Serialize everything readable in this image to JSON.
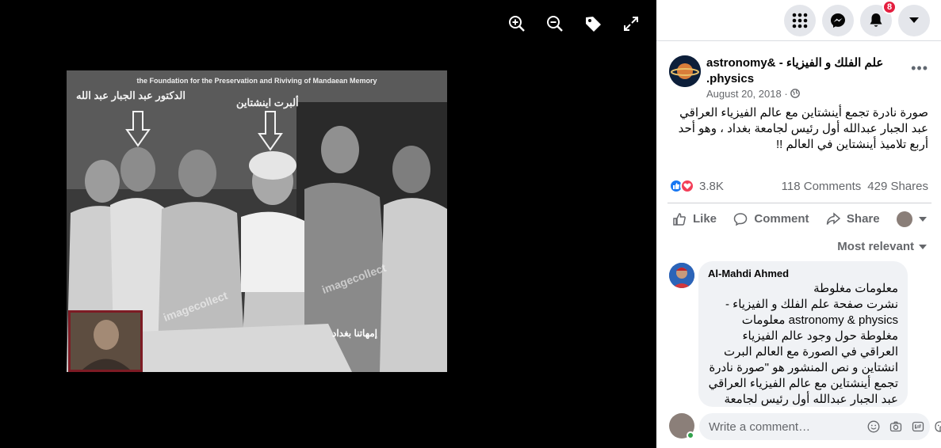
{
  "viewer": {
    "tools": [
      "zoom-in-icon",
      "zoom-out-icon",
      "tag-icon",
      "fullscreen-icon"
    ],
    "photo": {
      "caption": "the Foundation for the Preservation and Riviving of Mandaean Memory",
      "label_left": "الدكتور عبد الجبار عبد الله",
      "label_right": "ألبرت اينشتاين",
      "watermark_1": "imagecollect",
      "watermark_2": "imagecollect",
      "badge_text": "إمهاتنا بغداد"
    }
  },
  "topbar": {
    "notifications_count": "8",
    "icons": [
      "menu-grid-icon",
      "messenger-icon",
      "bell-icon",
      "caret-down-icon"
    ]
  },
  "post": {
    "page_name": "علم الفلك و الفيزياء - astronomy& physics.",
    "date": "August 20, 2018",
    "text": "صورة نادرة تجمع أينشتاين مع عالم الفيزياء العراقي عبد الجبار عبدالله أول رئيس لجامعة بغداد ، وهو أحد أربع تلاميذ أينشتاين في العالم !!",
    "reactions_count": "3.8K",
    "comments_count": "118 Comments",
    "shares_count": "429 Shares",
    "actions": {
      "like": "Like",
      "comment": "Comment",
      "share": "Share"
    }
  },
  "comments": {
    "filter": "Most relevant",
    "items": [
      {
        "author": "Al-Mahdi Ahmed",
        "text": "معلومات مغلوطة\nنشرت صفحة علم الفلك و الفيزياء - astronomy & physics معلومات مغلوطة حول وجود عالم الفيزياء العراقي في الصورة مع العالم البرت انشتاين و نص المنشور هو \"صورة نادرة تجمع أينشتاين مع عالم الفيزياء العراقي عبد الجبار عبدالله أول رئيس لجامعة ب..."
      }
    ],
    "write_placeholder": "Write a comment…"
  },
  "colors": {
    "brand": "#1877f2",
    "badge": "#e41e3f",
    "bubble": "#f0f2f5",
    "muted": "#65676b"
  }
}
